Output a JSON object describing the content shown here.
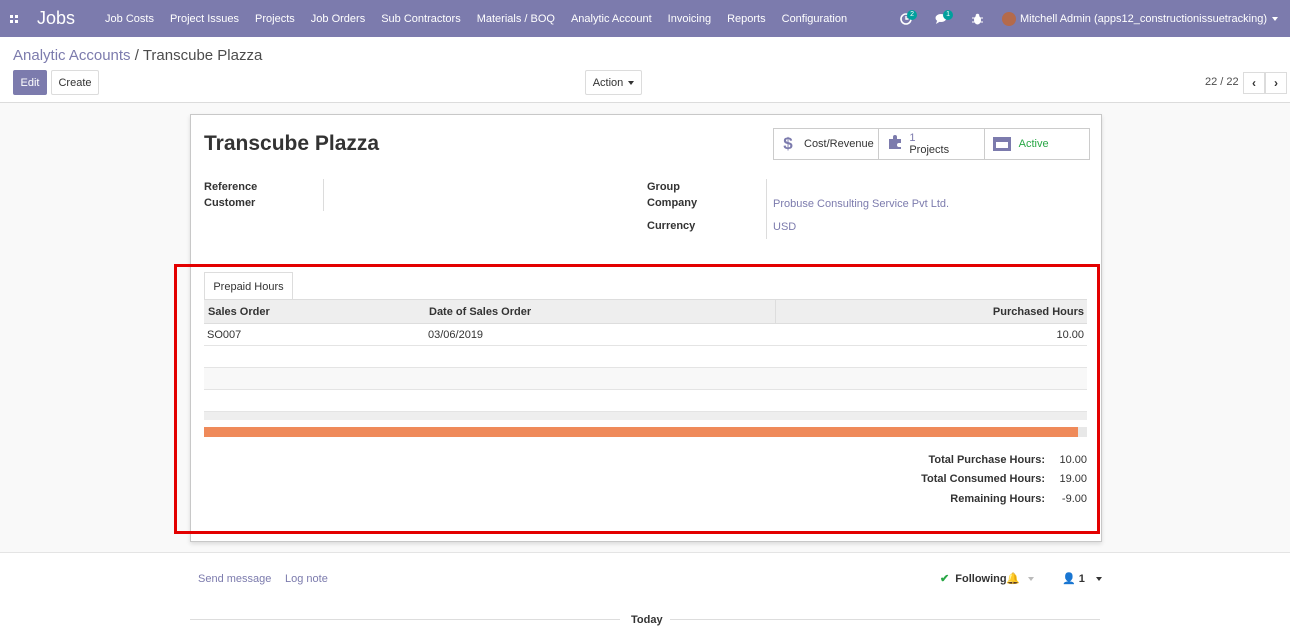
{
  "navbar": {
    "app_title": "Jobs",
    "menu": [
      "Job Costs",
      "Project Issues",
      "Projects",
      "Job Orders",
      "Sub Contractors",
      "Materials / BOQ",
      "Analytic Account",
      "Invoicing",
      "Reports",
      "Configuration"
    ],
    "activity_badge": "2",
    "messages_badge": "1",
    "user": "Mitchell Admin (apps12_constructionissuetracking)"
  },
  "breadcrumb": {
    "parent": "Analytic Accounts",
    "separator": "/",
    "current": "Transcube Plazza"
  },
  "toolbar": {
    "edit_label": "Edit",
    "create_label": "Create",
    "action_label": "Action",
    "pager": "22 / 22",
    "prev_icon": "‹",
    "next_icon": "›"
  },
  "form": {
    "title": "Transcube Plazza",
    "smart_buttons": {
      "cost_revenue": "Cost/Revenue",
      "projects_count": "1",
      "projects_label": "Projects",
      "active_label": "Active"
    },
    "left_fields": {
      "reference_label": "Reference",
      "customer_label": "Customer"
    },
    "right_fields": {
      "group_label": "Group",
      "company_label": "Company",
      "company_value": "Probuse Consulting Service Pvt Ltd.",
      "currency_label": "Currency",
      "currency_value": "USD"
    },
    "tab_label": "Prepaid Hours",
    "table": {
      "headers": [
        "Sales Order",
        "Date of Sales Order",
        "Purchased Hours"
      ],
      "rows": [
        {
          "sales_order": "SO007",
          "date": "03/06/2019",
          "hours": "10.00"
        }
      ]
    },
    "progress_fraction": 0.99,
    "totals": {
      "purchase_label": "Total Purchase Hours:",
      "purchase_value": "10.00",
      "consumed_label": "Total Consumed Hours:",
      "consumed_value": "19.00",
      "remaining_label": "Remaining Hours:",
      "remaining_value": "-9.00"
    }
  },
  "chatter": {
    "send_message": "Send message",
    "log_note": "Log note",
    "following": "Following",
    "followers_count": "1",
    "today": "Today"
  },
  "colors": {
    "brand": "#7c7bad",
    "progress": "#ef8a5a",
    "highlight": "#e30000",
    "active": "#28a745"
  }
}
